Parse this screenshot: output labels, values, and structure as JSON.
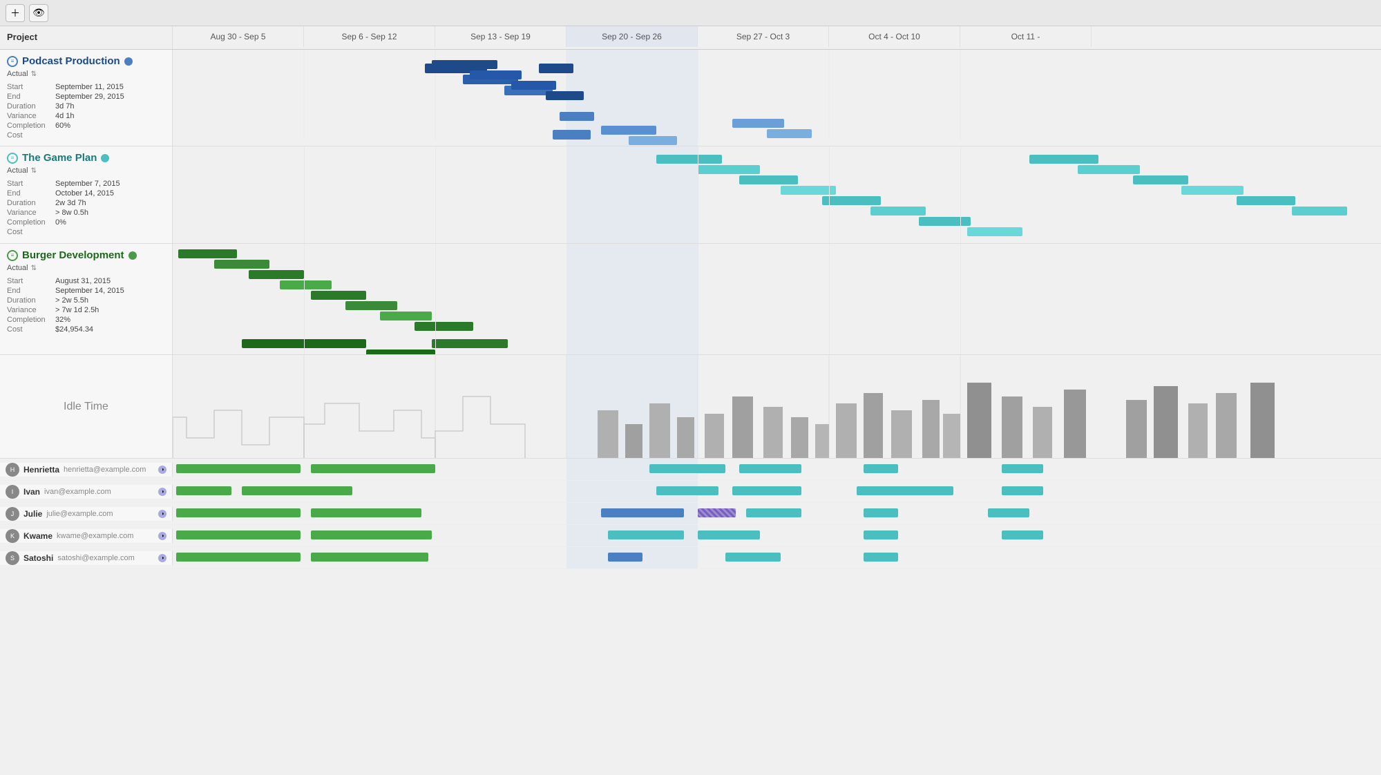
{
  "toolbar": {
    "add_label": "+",
    "eye_label": "👁"
  },
  "header": {
    "project_col": "Project",
    "weeks": [
      "Aug 30 - Sep 5",
      "Sep 6 - Sep 12",
      "Sep 13 - Sep 19",
      "Sep 20 - Sep 26",
      "Sep 27 - Oct 3",
      "Oct 4 - Oct 10",
      "Oct 11 -"
    ]
  },
  "projects": [
    {
      "id": "podcast",
      "title": "Podcast Production",
      "color_class": "blue",
      "actual_label": "Actual",
      "start": "September 11, 2015",
      "end": "September 29, 2015",
      "duration": "3d 7h",
      "variance": "4d 1h",
      "completion": "60%",
      "cost": ""
    },
    {
      "id": "gameplan",
      "title": "The Game Plan",
      "color_class": "cyan",
      "actual_label": "Actual",
      "start": "September 7, 2015",
      "end": "October 14, 2015",
      "duration": "2w 3d 7h",
      "variance": "> 8w 0.5h",
      "completion": "0%",
      "cost": ""
    },
    {
      "id": "burger",
      "title": "Burger Development",
      "color_class": "green",
      "actual_label": "Actual",
      "start": "August 31, 2015",
      "end": "September 14, 2015",
      "duration": "> 2w 5.5h",
      "variance": "> 7w 1d 2.5h",
      "completion": "32%",
      "cost": "$24,954.34"
    }
  ],
  "idle": {
    "title": "Idle Time"
  },
  "resources": [
    {
      "name": "Henrietta",
      "email": "henrietta@example.com"
    },
    {
      "name": "Ivan",
      "email": "ivan@example.com"
    },
    {
      "name": "Julie",
      "email": "julie@example.com"
    },
    {
      "name": "Kwame",
      "email": "kwame@example.com"
    },
    {
      "name": "Satoshi",
      "email": "satoshi@example.com"
    }
  ],
  "colors": {
    "blue_dark": "#1e4a8a",
    "blue_mid": "#4a7fc1",
    "blue_light": "#7aaedf",
    "cyan_dark": "#2a8888",
    "cyan_mid": "#4bbfbf",
    "cyan_light": "#8adede",
    "green_dark": "#1a6a1a",
    "green_mid": "#4aaa4a",
    "green_light": "#7acc7a",
    "gray": "#a0a0a0",
    "gray_dark": "#707070",
    "highlight_week": "Sep 20 - Sep 26"
  }
}
